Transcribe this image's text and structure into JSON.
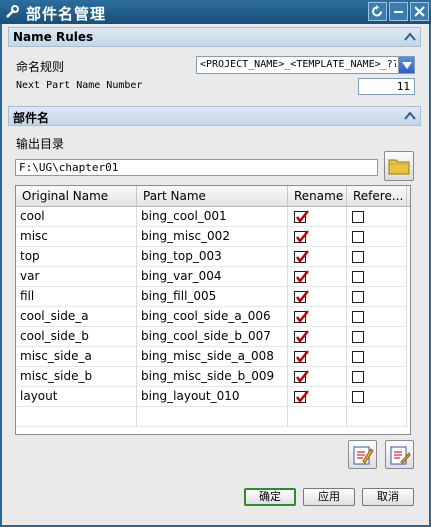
{
  "window": {
    "title": "部件名管理"
  },
  "icons": {
    "app": "wrench-icon",
    "reset": "reset-icon",
    "minimize": "minimize-icon",
    "close": "close-icon",
    "collapse": "chevron-up-icon",
    "folder": "folder-icon",
    "combo": "chevron-down-icon",
    "check": "checkmark-icon"
  },
  "colors": {
    "titlebar": "#1a4f78",
    "section_header": "#c4d6e8",
    "check": "#c00000",
    "default_button_border": "#2e8b2e"
  },
  "name_rules": {
    "header": "Name Rules",
    "naming_rule_label": "命名规则",
    "naming_rule_value": "<PROJECT_NAME>_<TEMPLATE_NAME>_??",
    "next_number_label": "Next Part Name Number",
    "next_number_value": "11"
  },
  "part_name": {
    "header": "部件名",
    "output_dir_label": "输出目录",
    "output_dir_value": "F:\\UG\\chapter01"
  },
  "table": {
    "columns": [
      "Original Name",
      "Part Name",
      "Rename",
      "Refere..."
    ],
    "rows": [
      {
        "original": "cool",
        "part": "bing_cool_001",
        "rename": true,
        "reference": false
      },
      {
        "original": "misc",
        "part": "bing_misc_002",
        "rename": true,
        "reference": false
      },
      {
        "original": "top",
        "part": "bing_top_003",
        "rename": true,
        "reference": false
      },
      {
        "original": "var",
        "part": "bing_var_004",
        "rename": true,
        "reference": false
      },
      {
        "original": "fill",
        "part": "bing_fill_005",
        "rename": true,
        "reference": false
      },
      {
        "original": "cool_side_a",
        "part": "bing_cool_side_a_006",
        "rename": true,
        "reference": false
      },
      {
        "original": "cool_side_b",
        "part": "bing_cool_side_b_007",
        "rename": true,
        "reference": false
      },
      {
        "original": "misc_side_a",
        "part": "bing_misc_side_a_008",
        "rename": true,
        "reference": false
      },
      {
        "original": "misc_side_b",
        "part": "bing_misc_side_b_009",
        "rename": true,
        "reference": false
      },
      {
        "original": "layout",
        "part": "bing_layout_010",
        "rename": true,
        "reference": false
      }
    ]
  },
  "actions": {
    "edit_icon": "edit-list-icon",
    "rename_icon": "rename-list-icon"
  },
  "buttons": {
    "ok": "确定",
    "apply": "应用",
    "cancel": "取消"
  }
}
